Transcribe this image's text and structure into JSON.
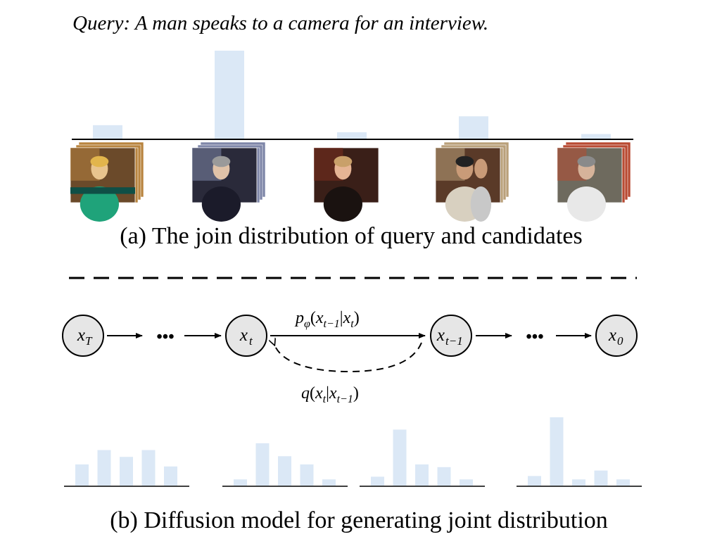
{
  "query_text": "Query:  A man speaks to a camera for an interview.",
  "caption_a": "(a) The join distribution of query and candidates",
  "caption_b": "(b) Diffusion model for generating joint distribution",
  "colors": {
    "bar": "#dbe8f6",
    "node_fill": "#e6e6e6",
    "line": "#000000"
  },
  "candidates": [
    {
      "score": 0.16,
      "thumbnail": "woman-news-anchor"
    },
    {
      "score": 1.0,
      "thumbnail": "man-in-suit-studio"
    },
    {
      "score": 0.08,
      "thumbnail": "man-street-closeup"
    },
    {
      "score": 0.26,
      "thumbnail": "two-men-indoors"
    },
    {
      "score": 0.06,
      "thumbnail": "man-in-beanie-outdoors"
    }
  ],
  "chain": {
    "nodes": [
      {
        "base": "x",
        "sub": "T"
      },
      {
        "base": "x",
        "sub": "t"
      },
      {
        "base": "x",
        "sub": "t−1"
      },
      {
        "base": "x",
        "sub": "0"
      }
    ],
    "ellipsis": "•••",
    "reverse_label": {
      "p": "p",
      "p_sub": "φ",
      "args": "(",
      "x1": "x",
      "x1_sub": "t−1",
      "bar": "|",
      "x2": "x",
      "x2_sub": "t",
      "close": ")"
    },
    "forward_label": {
      "q": "q",
      "args": "(",
      "x1": "x",
      "x1_sub": "t",
      "bar": "|",
      "x2": "x",
      "x2_sub": "t−1",
      "close": ")"
    }
  },
  "distributions": [
    {
      "values": [
        0.31,
        0.52,
        0.42,
        0.52,
        0.28
      ]
    },
    {
      "values": [
        0.09,
        0.62,
        0.43,
        0.31,
        0.09
      ]
    },
    {
      "values": [
        0.13,
        0.82,
        0.31,
        0.27,
        0.09
      ]
    },
    {
      "values": [
        0.14,
        1.0,
        0.09,
        0.22,
        0.09
      ]
    }
  ]
}
